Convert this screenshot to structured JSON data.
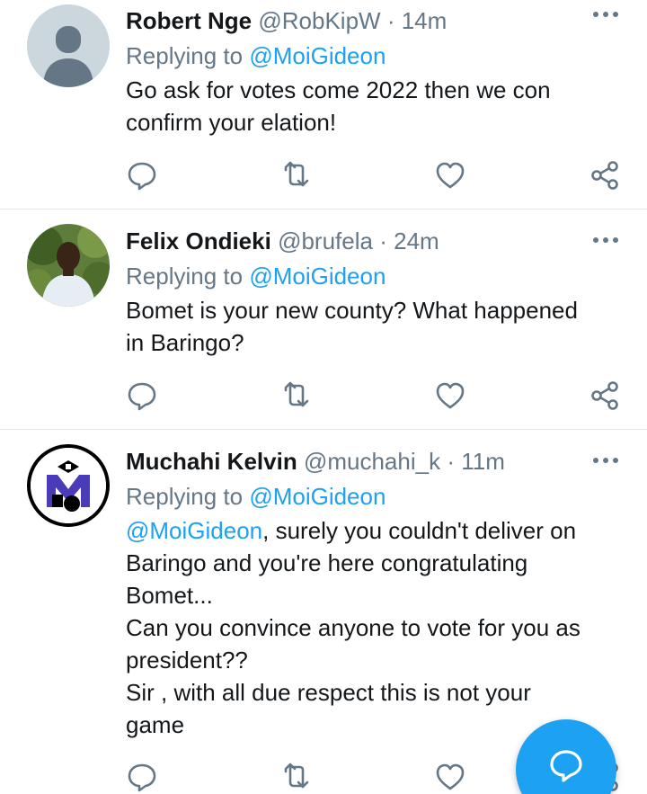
{
  "colors": {
    "accent": "#1da1f2",
    "text": "#14171a",
    "secondary": "#657786",
    "divider": "#e1e8ed"
  },
  "tweets": [
    {
      "name": "Robert Nge",
      "handle": "@RobKipW",
      "dot": "·",
      "time": "14m",
      "replying_prefix": "Replying to ",
      "replying_to": "@MoiGideon",
      "lines": [
        "Go ask for votes come 2022 then we con",
        "confirm your elation!"
      ],
      "avatar": "default-avatar-icon"
    },
    {
      "name": "Felix Ondieki",
      "handle": "@brufela",
      "dot": "·",
      "time": "24m",
      "replying_prefix": "Replying to ",
      "replying_to": "@MoiGideon",
      "lines": [
        "Bomet is your new county? What happened",
        "in Baringo?"
      ],
      "avatar": "profile-photo"
    },
    {
      "name": "Muchahi Kelvin",
      "handle": "@muchahi_k",
      "dot": "·",
      "time": "11m",
      "replying_prefix": "Replying to ",
      "replying_to": "@MoiGideon",
      "mention_in_body": "@MoiGideon",
      "first_line_rest": ", surely you couldn't deliver on",
      "lines": [
        "Baringo and you're here congratulating",
        "Bomet...",
        "Can you convince anyone to vote for you as",
        "president??",
        "Sir , with all due respect this is not your",
        "game"
      ],
      "avatar": "logo-m-avatar"
    }
  ],
  "icons": {
    "reply": "reply-icon",
    "retweet": "retweet-icon",
    "like": "heart-icon",
    "share": "share-icon",
    "more": "more-options-icon",
    "compose": "compose-reply-icon"
  }
}
